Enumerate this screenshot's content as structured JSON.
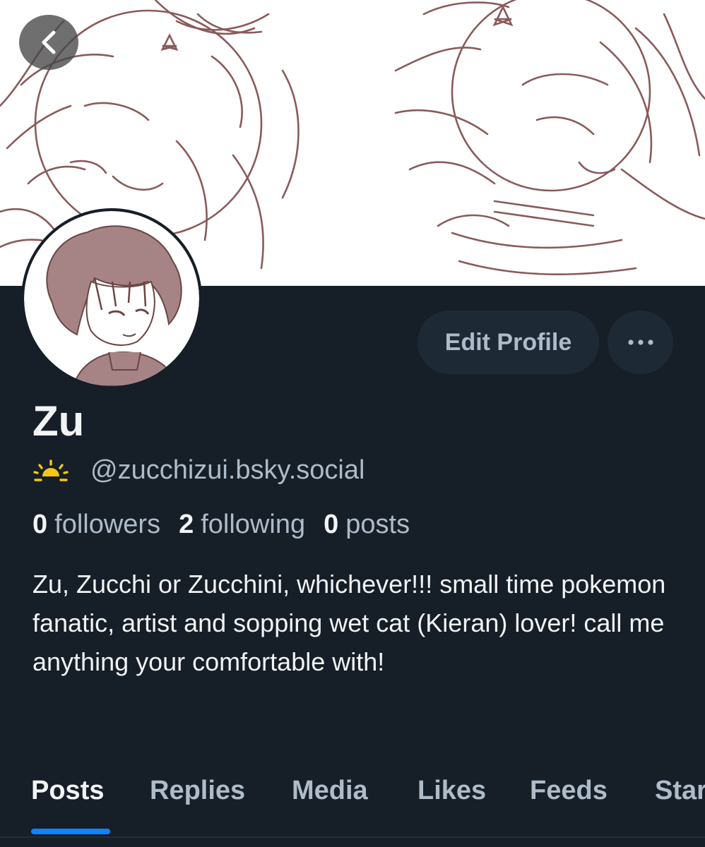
{
  "header": {
    "back_icon": "chevron-left-icon"
  },
  "profile": {
    "actions": {
      "edit_label": "Edit Profile",
      "more_icon": "ellipsis-icon"
    },
    "display_name": "Zu",
    "handle_icon": "sunrise-icon",
    "handle": "@zucchizui.bsky.social",
    "stats": {
      "followers_count": "0",
      "followers_label": "followers",
      "following_count": "2",
      "following_label": "following",
      "posts_count": "0",
      "posts_label": "posts"
    },
    "bio": "Zu, Zucchi or Zucchini, whichever!!! small time pokemon fanatic, artist and sopping wet cat (Kieran) lover! call me anything your comfortable with!"
  },
  "tabs": [
    {
      "label": "Posts",
      "active": true
    },
    {
      "label": "Replies"
    },
    {
      "label": "Media"
    },
    {
      "label": "Likes"
    },
    {
      "label": "Feeds"
    },
    {
      "label": "Starter Packs"
    }
  ],
  "colors": {
    "background": "#161e27",
    "accent": "#1083fe",
    "sketch_line": "#8a5a5a",
    "avatar_fill": "#a68485",
    "sun_icon": "#f5c518"
  }
}
